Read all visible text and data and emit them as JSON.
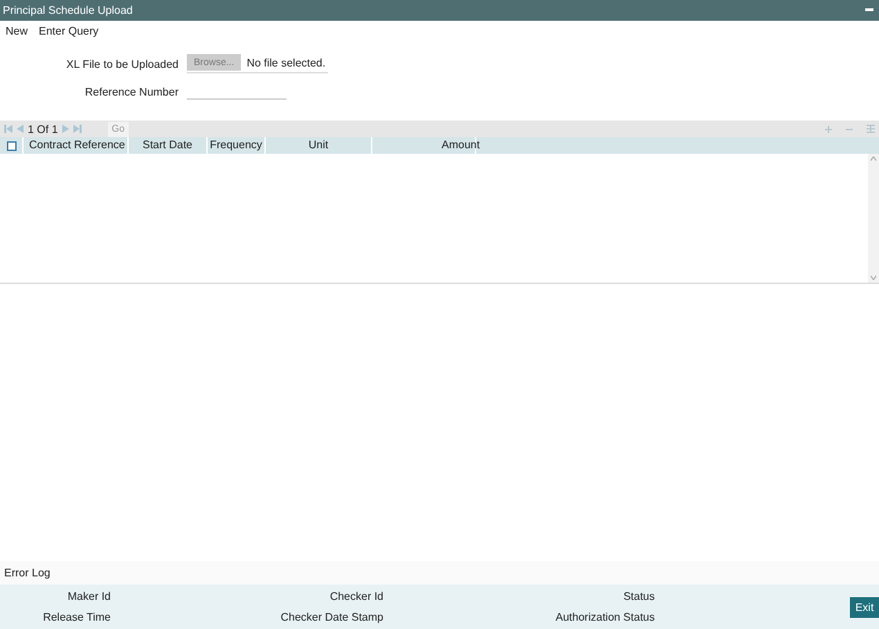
{
  "window": {
    "title": "Principal Schedule Upload"
  },
  "menu": [
    "New",
    "Enter Query"
  ],
  "form": {
    "fields": [
      {
        "kind": "file",
        "label": "XL File to be Uploaded",
        "button": "Browse...",
        "value": "No file selected."
      },
      {
        "kind": "text",
        "label": "Reference Number"
      }
    ]
  },
  "grid": {
    "page": "1 Of 1",
    "go": "Go",
    "select_all": {
      "checked": false
    },
    "columns": [
      "Contract Reference",
      "Start Date",
      "Frequency",
      "Unit",
      "Amount"
    ]
  },
  "error_log": "Error Log",
  "footer": {
    "fields": [
      "Maker Id",
      "Checker Id",
      "Status",
      "Release Time",
      "Checker Date Stamp",
      "Authorization Status"
    ],
    "button": "Exit"
  }
}
